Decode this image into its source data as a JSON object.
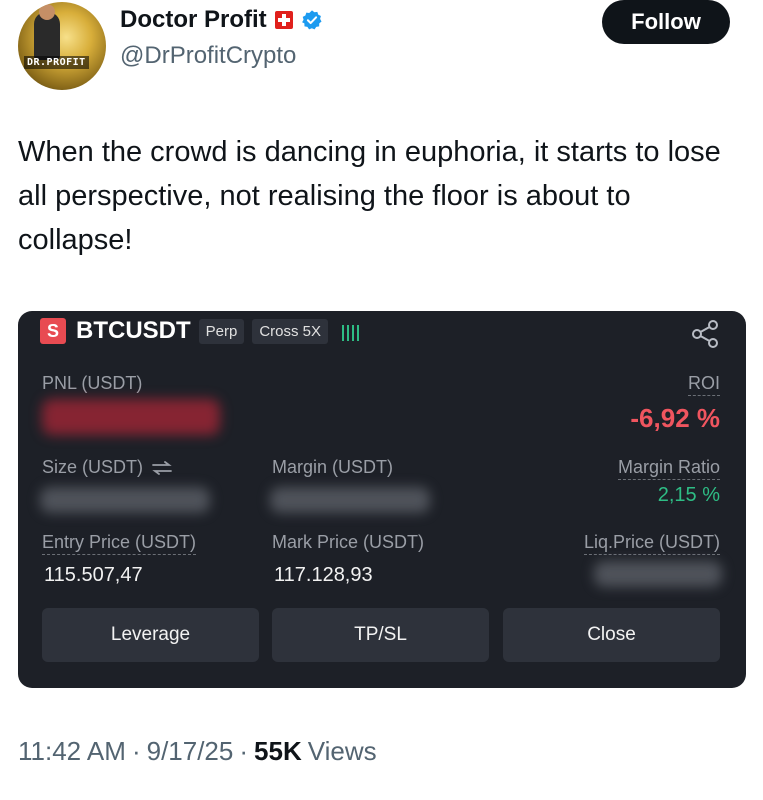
{
  "author": {
    "display_name": "Doctor Profit",
    "handle": "@DrProfitCrypto",
    "avatar_text": "DR.PROFIT",
    "flag_icon": "swiss-flag-icon",
    "verified_icon": "verified-badge-icon",
    "verified_color": "#1d9bf0"
  },
  "follow_label": "Follow",
  "tweet_text": "When the crowd is dancing in euphoria, it starts to lose all perspective, not realising the floor is about to collapse!",
  "position_card": {
    "side": "S",
    "symbol": "BTCUSDT",
    "tags": [
      "Perp",
      "Cross 5X"
    ],
    "indicator_text": "!!!!",
    "share_icon": "share-icon",
    "pnl_label": "PNL (USDT)",
    "roi_label": "ROI",
    "roi_value": "-6,92 %",
    "size_label": "Size (USDT)",
    "margin_label": "Margin (USDT)",
    "margin_ratio_label": "Margin Ratio",
    "margin_ratio_value": "2,15 %",
    "entry_price_label": "Entry Price (USDT)",
    "entry_price_value": "115.507,47",
    "mark_price_label": "Mark Price (USDT)",
    "mark_price_value": "117.128,93",
    "liq_price_label": "Liq.Price (USDT)",
    "buttons": [
      "Leverage",
      "TP/SL",
      "Close"
    ],
    "colors": {
      "background": "#1d2027",
      "short": "#e84b52",
      "negative": "#f0555f",
      "positive": "#2ebd85"
    }
  },
  "footer": {
    "time": "11:42 AM",
    "date": "9/17/25",
    "separator": "·",
    "views_count": "55K",
    "views_label": "Views"
  }
}
